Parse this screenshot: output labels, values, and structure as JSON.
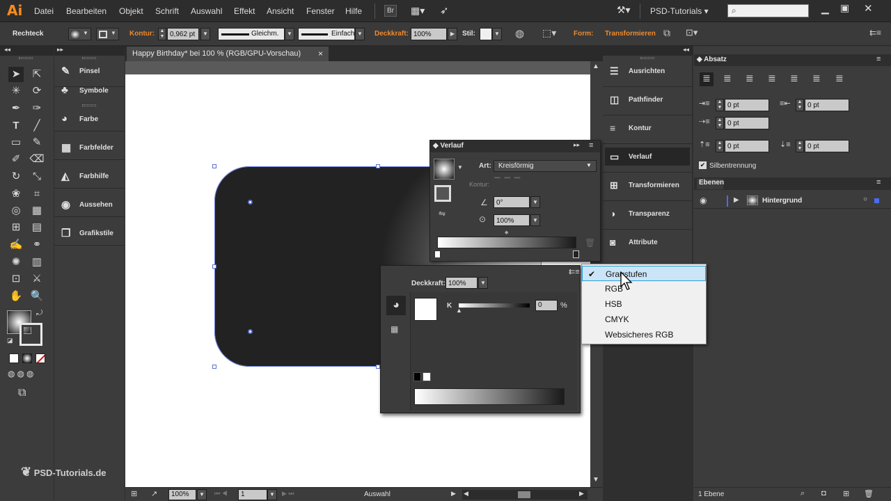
{
  "menubar": {
    "app_logo": "Ai",
    "items": [
      "Datei",
      "Bearbeiten",
      "Objekt",
      "Schrift",
      "Auswahl",
      "Effekt",
      "Ansicht",
      "Fenster",
      "Hilfe"
    ],
    "bridge_label": "Br",
    "workspace": "PSD-Tutorials",
    "search_placeholder": ""
  },
  "control_bar": {
    "object_type": "Rechteck",
    "kontur_label": "Kontur:",
    "kontur_value": "0,962 pt",
    "stroke_profile": "Gleichm.",
    "brush_profile": "Einfach",
    "deckkraft_label": "Deckkraft:",
    "deckkraft_value": "100%",
    "stil_label": "Stil:",
    "form_label": "Form:",
    "transformieren_label": "Transformieren"
  },
  "document": {
    "tab_title": "Happy Birthday* bei 100 % (RGB/GPU-Vorschau)",
    "close": "×"
  },
  "left_panels": [
    {
      "icon": "brush-icon",
      "label": "Pinsel",
      "glyph": "✎"
    },
    {
      "icon": "symbols-icon",
      "label": "Symbole",
      "glyph": "♣"
    },
    {
      "icon": "color-icon",
      "label": "Farbe",
      "glyph": "◕"
    },
    {
      "icon": "swatches-icon",
      "label": "Farbfelder",
      "glyph": "▦"
    },
    {
      "icon": "color-guide-icon",
      "label": "Farbhilfe",
      "glyph": "◭"
    },
    {
      "icon": "appearance-icon",
      "label": "Aussehen",
      "glyph": "◉"
    },
    {
      "icon": "graphic-styles-icon",
      "label": "Grafikstile",
      "glyph": "❒"
    }
  ],
  "right_panels": [
    {
      "icon": "align-icon",
      "label": "Ausrichten",
      "glyph": "☰"
    },
    {
      "icon": "pathfinder-icon",
      "label": "Pathfinder",
      "glyph": "◫"
    },
    {
      "icon": "stroke-icon",
      "label": "Kontur",
      "glyph": "≡"
    },
    {
      "icon": "gradient-icon",
      "label": "Verlauf",
      "glyph": "▭"
    },
    {
      "icon": "transform-icon",
      "label": "Transformieren",
      "glyph": "⊞"
    },
    {
      "icon": "transparency-icon",
      "label": "Transparenz",
      "glyph": "◑"
    },
    {
      "icon": "attributes-icon",
      "label": "Attribute",
      "glyph": "◙"
    }
  ],
  "gradient_panel": {
    "title": "Verlauf",
    "art_label": "Art:",
    "art_value": "Kreisförmig",
    "kontur_label": "Kontur:",
    "angle_value": "0°",
    "aspect_value": "100%"
  },
  "color_popup": {
    "deckkraft_label": "Deckkraft:",
    "deckkraft_value": "100%",
    "channel_label": "K",
    "channel_value": "0",
    "percent": "%"
  },
  "color_mode_menu": {
    "items": [
      "Graustufen",
      "RGB",
      "HSB",
      "CMYK",
      "Websicheres RGB"
    ],
    "checked": "Graustufen",
    "check_glyph": "✔"
  },
  "absatz_panel": {
    "title": "Absatz",
    "indent_left": "0 pt",
    "indent_right": "0 pt",
    "first_line": "0 pt",
    "space_before": "0 pt",
    "space_after": "0 pt",
    "hyphenation": "Silbentrennung"
  },
  "ebenen_panel": {
    "title": "Ebenen",
    "layer_name": "Hintergrund",
    "layer_count": "1 Ebene",
    "layer_color": "#4a6cf0"
  },
  "statusbar": {
    "zoom": "100%",
    "artboard": "1",
    "status": "Auswahl"
  },
  "watermark": "PSD-Tutorials.de"
}
